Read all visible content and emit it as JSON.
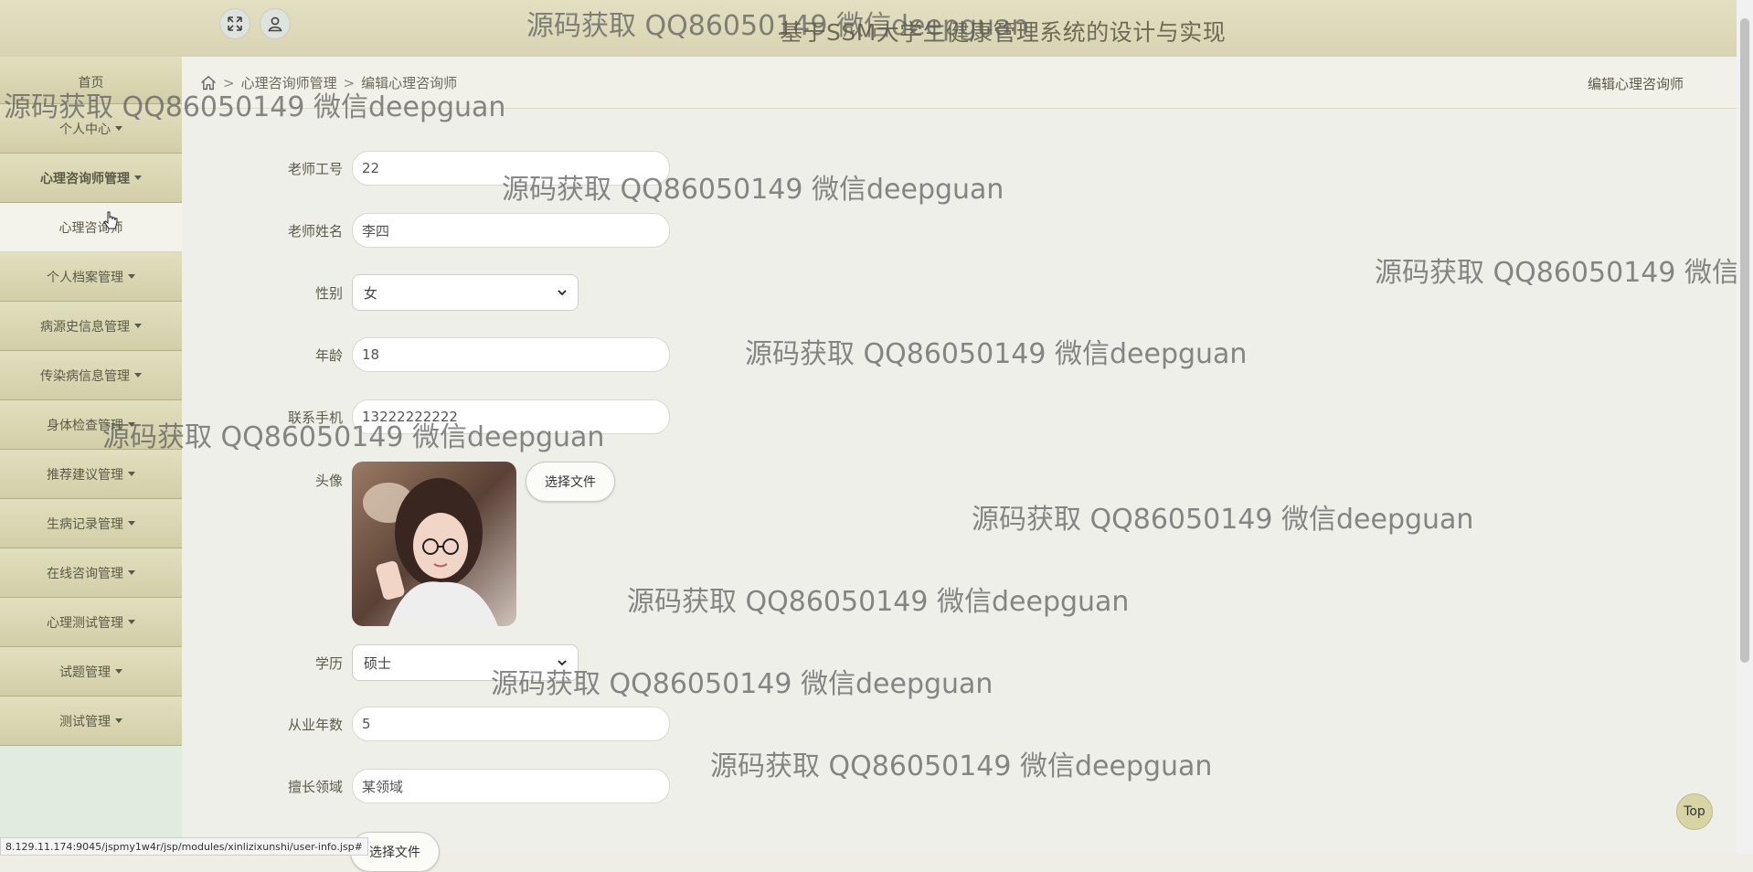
{
  "header": {
    "title": "基于SSM大学生健康管理系统的设计与实现",
    "fullscreen_icon": "expand-arrows-icon",
    "user_icon": "user-icon"
  },
  "sidebar": {
    "home": "首页",
    "items": [
      {
        "label": "个人中心"
      },
      {
        "label": "心理咨询师管理",
        "open": true,
        "sub": "心理咨询师"
      },
      {
        "label": "个人档案管理"
      },
      {
        "label": "病源史信息管理"
      },
      {
        "label": "传染病信息管理"
      },
      {
        "label": "身体检查管理"
      },
      {
        "label": "推荐建议管理"
      },
      {
        "label": "生病记录管理"
      },
      {
        "label": "在线咨询管理"
      },
      {
        "label": "心理测试管理"
      },
      {
        "label": "试题管理"
      },
      {
        "label": "测试管理"
      }
    ]
  },
  "breadcrumb": {
    "home_icon": "home-icon",
    "sep": ">",
    "level1": "心理咨询师管理",
    "level2": "编辑心理咨询师"
  },
  "page_heading": "编辑心理咨询师",
  "form": {
    "teacher_no": {
      "label": "老师工号",
      "value": "22"
    },
    "teacher_name": {
      "label": "老师姓名",
      "value": "李四"
    },
    "gender": {
      "label": "性别",
      "value": "女"
    },
    "age": {
      "label": "年龄",
      "value": "18"
    },
    "phone": {
      "label": "联系手机",
      "value": "13222222222"
    },
    "avatar": {
      "label": "头像",
      "button": "选择文件"
    },
    "education": {
      "label": "学历",
      "value": "硕士"
    },
    "years": {
      "label": "从业年数",
      "value": "5"
    },
    "field": {
      "label": "擅长领域",
      "value": "某领域"
    },
    "file2_button": "选择文件"
  },
  "top_button": "Top",
  "status_url": "8.129.11.174:9045/jspmy1w4r/jsp/modules/xinlizixunshi/user-info.jsp#",
  "watermark": "源码获取 QQ86050149 微信deepguan",
  "colors": {
    "header_bg": "#dcd8b6",
    "sidebar_item_bg": "#d8d4ae",
    "main_bg": "#efefea",
    "top_button_bg": "#d8d4a4"
  }
}
